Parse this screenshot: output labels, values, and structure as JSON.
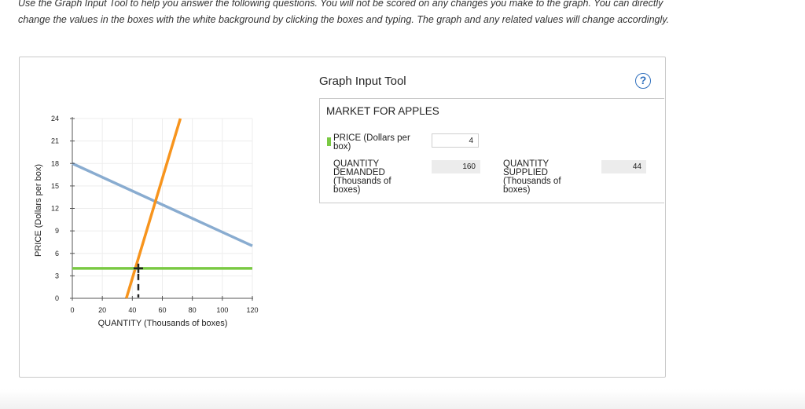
{
  "instructions": {
    "line1": "Use the Graph Input Tool to help you answer the following questions. You will not be scored on any changes you make to the graph. You can directly",
    "line2": "change the values in the boxes with the white background by clicking the boxes and typing. The graph and any related values will change accordingly."
  },
  "graph": {
    "ylabel": "PRICE (Dollars per box)",
    "xlabel": "QUANTITY (Thousands of boxes)",
    "y_ticks": [
      "0",
      "3",
      "6",
      "9",
      "12",
      "15",
      "18",
      "21",
      "24"
    ],
    "x_ticks": [
      "0",
      "20",
      "40",
      "60",
      "80",
      "100",
      "120"
    ],
    "colors": {
      "demand": "#89acd0",
      "supply": "#f7941d",
      "price_line": "#7ac943",
      "marker": "#222222"
    }
  },
  "chart_data": {
    "type": "line",
    "xlabel": "QUANTITY (Thousands of boxes)",
    "ylabel": "PRICE (Dollars per box)",
    "xlim": [
      0,
      120
    ],
    "ylim": [
      0,
      24
    ],
    "grid": true,
    "series": [
      {
        "x": [
          0,
          120
        ],
        "y": [
          18,
          7
        ]
      },
      {
        "x": [
          36,
          72
        ],
        "y": [
          0,
          24
        ]
      },
      {
        "x": [
          0,
          120
        ],
        "y": [
          4,
          4
        ]
      }
    ],
    "markers": [
      {
        "x": [
          44,
          44
        ],
        "y": [
          4,
          0
        ],
        "style": "dashed"
      }
    ]
  },
  "tool": {
    "title": "Graph Input Tool",
    "help": "?",
    "market_title": "MARKET FOR APPLES",
    "price_label_1": "PRICE (Dollars per",
    "price_label_2": "box)",
    "price_value": "4",
    "qd_label_1": "QUANTITY",
    "qd_label_2": "DEMANDED",
    "qd_label_3": "(Thousands of",
    "qd_label_4": "boxes)",
    "qd_value": "160",
    "qs_label_1": "QUANTITY",
    "qs_label_2": "SUPPLIED",
    "qs_label_3": "(Thousands of",
    "qs_label_4": "boxes)",
    "qs_value": "44"
  }
}
